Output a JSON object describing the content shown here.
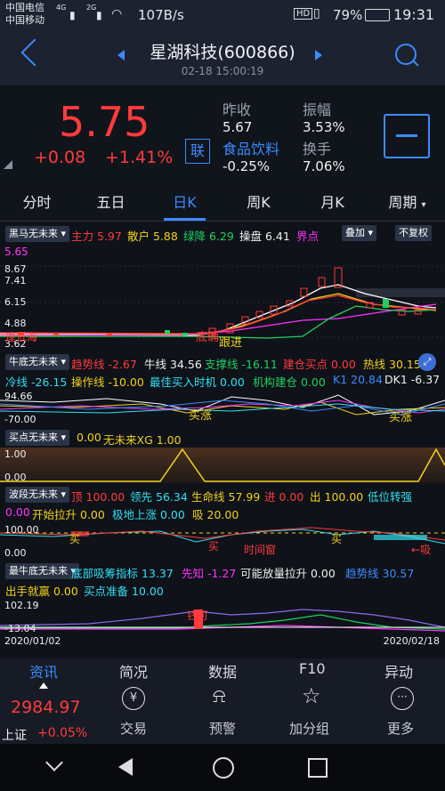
{
  "status": {
    "carrier1": "中国电信",
    "carrier2": "中国移动",
    "net": "4G",
    "net2": "2G",
    "speed": "107B/s",
    "battery": "79%",
    "time": "19:31"
  },
  "header": {
    "title": "星湖科技(600866)",
    "datetime": "02-18 15:00:19"
  },
  "quote": {
    "price": "5.75",
    "change": "+0.08",
    "pct": "+1.41%",
    "prev_close_label": "昨收",
    "prev_close": "5.67",
    "amplitude_label": "振幅",
    "amplitude": "3.53%",
    "sector": "食品饮料",
    "sector_pct": "-0.25%",
    "turnover_label": "换手",
    "turnover": "7.06%",
    "lian": "联"
  },
  "tabs": [
    "分时",
    "五日",
    "日K",
    "周K",
    "月K",
    "周期"
  ],
  "main_ind": {
    "name": "黑马无未来",
    "zl_label": "主力",
    "zl": "5.97",
    "sh_label": "散户",
    "sh": "5.88",
    "lj_label": "绿降",
    "lj": "6.29",
    "cp_label": "操盘",
    "cp": "6.41",
    "jd_label": "界点",
    "overlay": "叠加",
    "fq": "不复权"
  },
  "main_axis": {
    "top": "5.65",
    "l1": "8.67",
    "l2": "7.41",
    "l3": "6.15",
    "l4": "4.88",
    "l5": "3.62"
  },
  "main_marks": {
    "bdh": "逢低海",
    "dk": "底确",
    "gj": "跟进"
  },
  "ind2": {
    "name": "牛底无未来",
    "qsx_label": "趋势线",
    "qsx": "-2.67",
    "nx_label": "牛线",
    "nx": "34.56",
    "zcx_label": "支撑线",
    "zcx": "-16.11",
    "jc_label": "建仓买点",
    "jc": "0.00",
    "rx_label": "热线",
    "rx": "30.15",
    "lx_label": "冷线",
    "lx": "-26.15",
    "czx_label": "操作线",
    "czx": "-10.00",
    "zj_label": "最佳买入时机",
    "zj": "0.00",
    "jg_label": "机构建仓",
    "jg": "0.00",
    "k1_label": "K1",
    "k1": "20.84",
    "dk1_label": "DK1",
    "dk1": "-6.37",
    "axis_top": "94.66",
    "axis_bot": "-70.00",
    "mark1": "买涨",
    "mark2": "买涨"
  },
  "ind3": {
    "name": "买点无未来",
    "v1": "0.00",
    "xg_label": "无未来XG",
    "xg": "1.00",
    "axis_top": "1.00",
    "axis_bot": "0.00"
  },
  "ind4": {
    "name": "波段无未来",
    "d_label": "顶",
    "d": "100.00",
    "lx_label": "领先",
    "lx": "56.34",
    "smx_label": "生命线",
    "smx": "57.99",
    "j_label": "进",
    "j": "0.00",
    "c_label": "出",
    "c": "100.00",
    "dw_label": "低位转强",
    "v2": "0.00",
    "ks_label": "开始拉升",
    "ks": "0.00",
    "jd_label": "极地上涨",
    "jd": "0.00",
    "x_label": "吸",
    "x": "20.00",
    "axis_top": "100.00",
    "axis_bot": "0.00",
    "m1": "买",
    "m2": "买",
    "m3": "时间窗",
    "m4": "买",
    "m5": "←吸"
  },
  "ind5": {
    "name": "最牛底无未来",
    "dbx_label": "底部吸筹指标",
    "dbx": "13.37",
    "xz_label": "先知",
    "xz": "-1.27",
    "kn_label": "可能放量拉升",
    "kn": "0.00",
    "qs_label": "趋势线",
    "qs": "30.57",
    "cs_label": "出手就赢",
    "cs": "0.00",
    "md_label": "买点准备",
    "md": "10.00",
    "axis_top": "102.19",
    "axis_bot": "-13.04",
    "mark": "钱可"
  },
  "dates": {
    "start": "2020/01/02",
    "end": "2020/02/18"
  },
  "bottom": {
    "tabs": [
      "资讯",
      "简况",
      "数据",
      "F10",
      "异动"
    ],
    "index_val": "2984.97",
    "index_name": "上证",
    "index_pct": "+0.05%",
    "actions": [
      "交易",
      "预警",
      "加分组",
      "更多"
    ]
  },
  "colors": {
    "up": "#ff3b3b",
    "down": "#20d060",
    "accent": "#3d8bff"
  }
}
